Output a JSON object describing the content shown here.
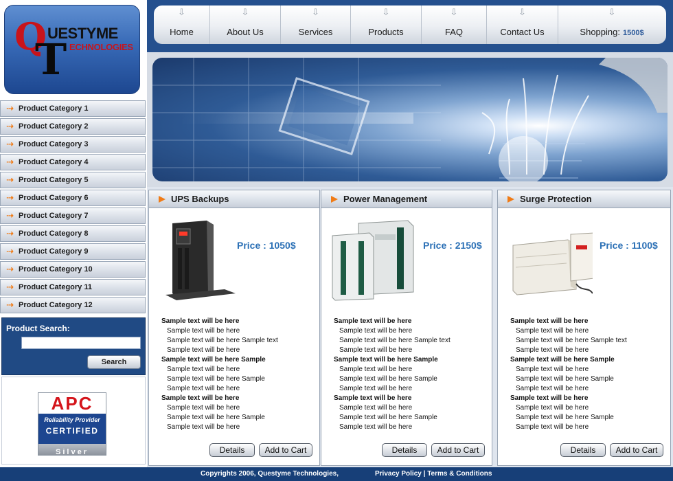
{
  "brand": {
    "logo_letter_q": "Q",
    "logo_letter_t": "T",
    "logo_line1": "UESTYME",
    "logo_line2": "ECHNOLOGIES"
  },
  "nav": {
    "items": [
      {
        "label": "Home",
        "icon": "download-arrow-icon"
      },
      {
        "label": "About Us",
        "icon": "download-arrow-icon"
      },
      {
        "label": "Services",
        "icon": "download-arrow-icon"
      },
      {
        "label": "Products",
        "icon": "download-arrow-icon"
      },
      {
        "label": "FAQ",
        "icon": "download-arrow-icon"
      },
      {
        "label": "Contact Us",
        "icon": "download-arrow-icon"
      },
      {
        "label": "Shopping:",
        "icon": "download-arrow-icon"
      }
    ],
    "cart_amount": "1500$"
  },
  "sidebar": {
    "categories": [
      "Product Category 1",
      "Product Category 2",
      "Product Category 3",
      "Product Category 4",
      "Product Category 5",
      "Product Category 6",
      "Product Category 7",
      "Product Category 8",
      "Product Category 9",
      "Product Category 10",
      "Product Category 11",
      "Product Category 12"
    ],
    "search": {
      "title": "Product Search:",
      "value": "",
      "button": "Search"
    },
    "badge": {
      "brand": "APC",
      "tagline": "Reliability Provider",
      "certified": "CERTIFIED",
      "level": "Silver"
    }
  },
  "colors": {
    "accent": "#f07b16",
    "price": "#2a6fb5",
    "header_blue": "#25508e",
    "footer_blue": "#173f78"
  },
  "products": [
    {
      "title": "UPS Backups",
      "price": "Price : 1050$",
      "details": "Details",
      "add_to_cart": "Add to Cart",
      "lines": [
        {
          "text": "Sample text will be here",
          "bold": true
        },
        {
          "text": "Sample text will be here",
          "bold": false
        },
        {
          "text": "Sample text will be here Sample text",
          "bold": false
        },
        {
          "text": "Sample text will be here",
          "bold": false
        },
        {
          "text": "Sample text will be here Sample",
          "bold": true
        },
        {
          "text": "Sample text will be here",
          "bold": false
        },
        {
          "text": "Sample text will be here Sample",
          "bold": false
        },
        {
          "text": "Sample text will be here",
          "bold": false
        },
        {
          "text": "Sample text will be here",
          "bold": true
        },
        {
          "text": "Sample text will be here",
          "bold": false
        },
        {
          "text": "Sample text will be here Sample",
          "bold": false
        },
        {
          "text": "Sample text will be here",
          "bold": false
        }
      ]
    },
    {
      "title": "Power Management",
      "price": "Price : 2150$",
      "details": "Details",
      "add_to_cart": "Add to Cart",
      "lines": [
        {
          "text": "Sample text will be here",
          "bold": true
        },
        {
          "text": "Sample text will be here",
          "bold": false
        },
        {
          "text": "Sample text will be here Sample text",
          "bold": false
        },
        {
          "text": "Sample text will be here",
          "bold": false
        },
        {
          "text": "Sample text will be here Sample",
          "bold": true
        },
        {
          "text": "Sample text will be here",
          "bold": false
        },
        {
          "text": "Sample text will be here Sample",
          "bold": false
        },
        {
          "text": "Sample text will be here",
          "bold": false
        },
        {
          "text": "Sample text will be here",
          "bold": true
        },
        {
          "text": "Sample text will be here",
          "bold": false
        },
        {
          "text": "Sample text will be here Sample",
          "bold": false
        },
        {
          "text": "Sample text will be here",
          "bold": false
        }
      ]
    },
    {
      "title": "Surge Protection",
      "price": "Price : 1100$",
      "details": "Details",
      "add_to_cart": "Add to Cart",
      "lines": [
        {
          "text": "Sample text will be here",
          "bold": true
        },
        {
          "text": "Sample text will be here",
          "bold": false
        },
        {
          "text": "Sample text will be here Sample text",
          "bold": false
        },
        {
          "text": "Sample text will be here",
          "bold": false
        },
        {
          "text": "Sample text will be here Sample",
          "bold": true
        },
        {
          "text": "Sample text will be here",
          "bold": false
        },
        {
          "text": "Sample text will be here Sample",
          "bold": false
        },
        {
          "text": "Sample text will be here",
          "bold": false
        },
        {
          "text": "Sample text will be here",
          "bold": true
        },
        {
          "text": "Sample text will be here",
          "bold": false
        },
        {
          "text": "Sample text will be here Sample",
          "bold": false
        },
        {
          "text": "Sample text will be here",
          "bold": false
        }
      ]
    }
  ],
  "footer": {
    "copyright": "Copyrights 2006, Questyme Technologies,",
    "privacy": "Privacy Policy",
    "separator": " | ",
    "terms": "Terms & Conditions"
  }
}
